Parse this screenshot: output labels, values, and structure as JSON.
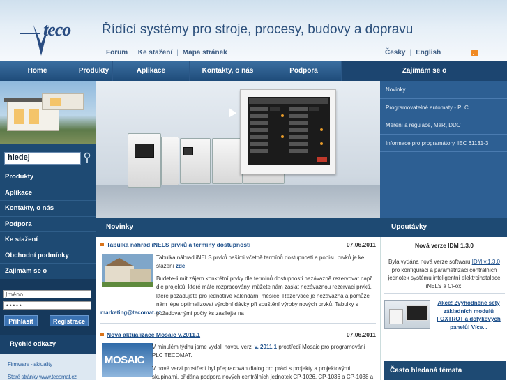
{
  "brand": {
    "logo_text": "teco",
    "title": "Řídící systémy pro stroje, procesy, budovy a dopravu"
  },
  "topnav": {
    "items": [
      "Forum",
      "Ke stažení",
      "Mapa stránek"
    ],
    "separator": "|"
  },
  "languages": [
    "Česky",
    "English"
  ],
  "mainnav": {
    "items": [
      "Home",
      "Produkty",
      "Aplikace",
      "Kontakty, o nás",
      "Podpora",
      "Zajímám se o"
    ]
  },
  "search": {
    "value": "hledej"
  },
  "leftmenu": {
    "items": [
      "Produkty",
      "Aplikace",
      "Kontakty, o nás",
      "Podpora",
      "Ke stažení",
      "Obchodní podmínky",
      "Zajímám se o"
    ]
  },
  "login": {
    "name_placeholder": "Jméno",
    "password_value": "•••••",
    "login_label": "Přihlásit",
    "register_label": "Registrace"
  },
  "quick": {
    "title": "Rychlé odkazy",
    "links": [
      "Firmware - aktuality",
      "Staré stránky www.tecomat.cz"
    ]
  },
  "rightmenu": {
    "items": [
      "Novinky",
      "Programovatelné automaty - PLC",
      "Měření a regulace, MaR, DDC",
      "Informace pro programátory, IEC 61131-3"
    ]
  },
  "news": {
    "title": "Novinky",
    "items": [
      {
        "title": "Tabulka náhrad iNELS prvků a termíny dostupnosti",
        "date": "07.06.2011",
        "p1_a": "Tabulka náhrad iNELS prvků našimi včetně termínů dostupnosti a popisu prvků je ke stažení",
        "p1_link": "zde",
        "p2": "Budete-li mít zájem konkrétní prvky dle termínů dostupnosti nezávazně rezervovat např. dle projektů, které máte rozpracovány, můžete nám zaslat nezávaznou rezervaci prvků, které požadujete pro jednotlivé kalendářní měsíce. Rezervace je nezávazná a pomůže nám lépe optimalizovat výrobní dávky při spuštění výroby nových prvků. Tabulky s požadovanými počty ks zasílejte na",
        "p2_link": "marketing@tecomat.cz"
      },
      {
        "title": "Nová aktualizace Mosaic v.2011.1",
        "date": "07.06.2011",
        "p1_a": "V minulém týdnu jsme vydali novou verzi",
        "p1_link": "v. 2011.1",
        "p1_b": "prostředí Mosaic pro programování PLC TECOMAT.",
        "p2": "V nové verzi prostředí byl přepracován dialog pro práci s projekty a projektovými skupinami, přidána podpora nových centrálních jednotek CP-1026, CP-1036 a CP-1038 a",
        "img_label": "MOSAIC"
      }
    ]
  },
  "tips": {
    "title": "Upoutávky",
    "item1_title": "Nová verze IDM 1.3.0",
    "item1_text_a": "Byla vydána nová verze softwaru",
    "item1_link": "IDM v.1.3.0",
    "item1_text_b": "pro konfiguraci a parametrizaci centrálních jednotek systému inteligentní elektroinstalace iNELS a CFox.",
    "item2_link": "Akce! Zvýhodněné sety základních modulů FOXTROT a dotykových panelů! Více...",
    "hot_title": "Často hledaná témata"
  },
  "colors": {
    "nav": "#1f4c7a",
    "accent": "#d9731a",
    "link": "#1b4e8a"
  }
}
